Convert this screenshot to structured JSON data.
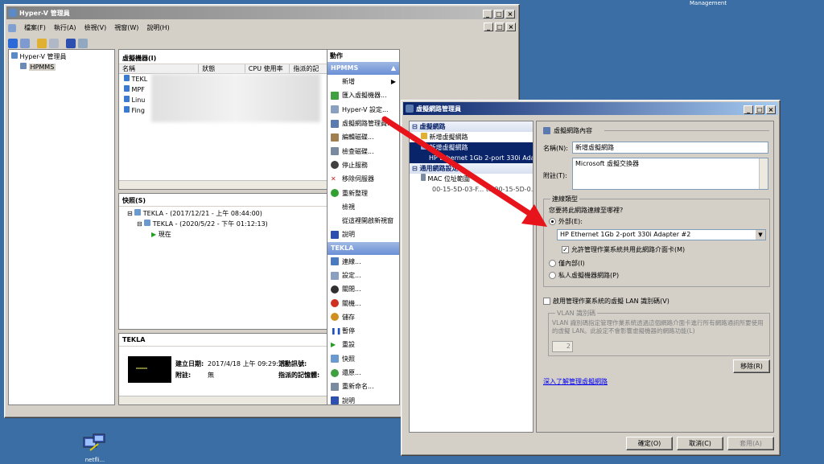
{
  "desktop": {
    "top_label": "Management",
    "icon_label": "netfli..."
  },
  "main_window": {
    "title": "Hyper-V 管理員",
    "menu": [
      "檔案(F)",
      "執行(A)",
      "檢視(V)",
      "視窗(W)",
      "說明(H)"
    ],
    "tree": {
      "root": "Hyper-V 管理員",
      "server": "HPMMS"
    },
    "vm_pane": {
      "title": "虛擬機器(I)",
      "columns": [
        "名稱",
        "狀態",
        "CPU 使用率",
        "指派的記"
      ],
      "rows": [
        "TEKL",
        "MPF",
        "Linu",
        "Fing"
      ]
    },
    "snapshot_pane": {
      "title": "快照(S)",
      "items": [
        "TEKLA - (2017/12/21 - 上午 08:44:00)",
        "TEKLA - (2020/5/22 - 下午 01:12:13)",
        "現在"
      ]
    },
    "detail_pane": {
      "title": "TEKLA",
      "created_label": "建立日期:",
      "created_value": "2017/4/18 上午 09:29:29",
      "notes_label": "附註:",
      "notes_value": "無",
      "heartbeat_label": "活動訊號:",
      "memory_label": "指派的記憶體:"
    },
    "actions": {
      "title": "動作",
      "section1": "HPMMS",
      "items1": [
        "新增",
        "匯入虛擬機器...",
        "Hyper-V 設定...",
        "虛擬網路管理員...",
        "編輯磁碟...",
        "檢查磁碟...",
        "停止服務",
        "移除伺服器",
        "重新整理",
        "檢視",
        "從這裡開啟新視窗",
        "說明"
      ],
      "section2": "TEKLA",
      "items2": [
        "連線...",
        "設定...",
        "關閉...",
        "關機...",
        "儲存",
        "暫停",
        "重設",
        "快照",
        "還原...",
        "重新命名...",
        "說明"
      ]
    }
  },
  "dialog": {
    "title": "虛擬網路管理員",
    "left": {
      "section1": "虛擬網路",
      "item_new": "新增虛擬網路",
      "item_selected": "新增虛擬網路",
      "item_selected_sub": "HP Ethernet 1Gb 2-port 330i Adap...",
      "section2": "通用網路設定",
      "mac_label": "MAC 位址範圍",
      "mac_value": "00-15-5D-03-F... to 00-15-5D-0..."
    },
    "right": {
      "header": "虛擬網路內容",
      "name_label": "名稱(N):",
      "name_value": "新增虛擬網路",
      "notes_label": "附註(T):",
      "notes_value": "Microsoft 虛擬交換器",
      "conn_group": "連線類型",
      "conn_question": "您要將此網路連線至哪裡?",
      "external": "外部(E):",
      "adapter": "HP Ethernet 1Gb 2-port 330i Adapter #2",
      "allow_share": "允許管理作業系統共用此網路介面卡(M)",
      "internal": "僅內部(I)",
      "private": "私人虛擬機器網路(P)",
      "vlan_check": "啟用管理作業系統的虛擬 LAN 識別碼(V)",
      "vlan_group": "VLAN 識別碼",
      "vlan_desc": "VLAN 識別碼指定管理作業系統透過這個網路介面卡進行所有網路通訊所要使用的虛擬 LAN。此設定不會影響虛擬機器的網路功能(L)",
      "vlan_value": "2",
      "remove": "移除(R)",
      "link": "深入了解管理虛擬網路"
    },
    "buttons": {
      "ok": "確定(O)",
      "cancel": "取消(C)",
      "apply": "套用(A)"
    }
  },
  "colors": {
    "desktop": "#3a6ea5",
    "arrow": "#e8141b",
    "selection": "#0a246a"
  }
}
